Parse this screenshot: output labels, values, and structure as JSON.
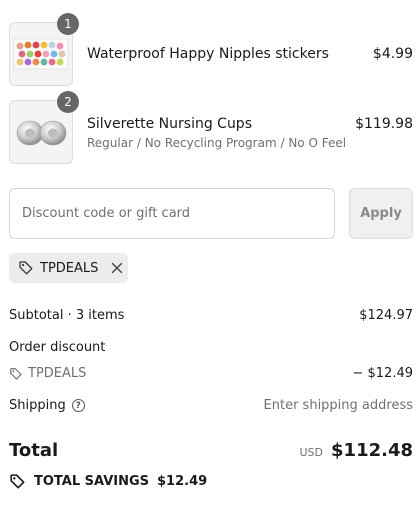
{
  "cart": {
    "items": [
      {
        "quantity": "1",
        "name": "Waterproof Happy Nipples stickers",
        "variant": "",
        "price": "$4.99",
        "image_icon": "sticker-sheet-image"
      },
      {
        "quantity": "2",
        "name": "Silverette Nursing Cups",
        "variant": "Regular / No Recycling Program / No O Feel",
        "price": "$119.98",
        "image_icon": "silver-cups-image"
      }
    ]
  },
  "discount": {
    "placeholder": "Discount code or gift card",
    "apply_label": "Apply",
    "applied_code": "TPDEALS"
  },
  "summary": {
    "subtotal_label": "Subtotal · 3 items",
    "subtotal_value": "$124.97",
    "order_discount_label": "Order discount",
    "discount_code": "TPDEALS",
    "discount_value": "− $12.49",
    "shipping_label": "Shipping",
    "shipping_value": "Enter shipping address",
    "total_label": "Total",
    "currency": "USD",
    "total_value": "$112.48",
    "savings_label": "TOTAL SAVINGS",
    "savings_value": "$12.49"
  }
}
